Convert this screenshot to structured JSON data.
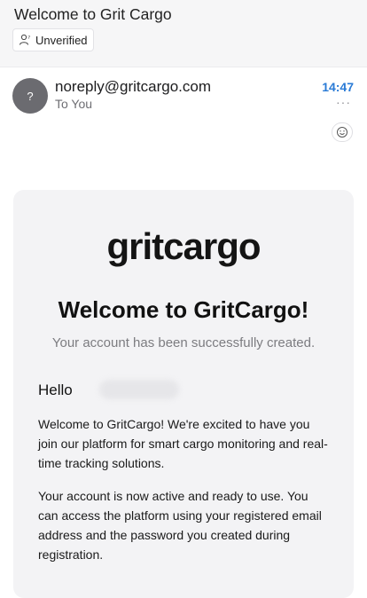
{
  "email": {
    "subject": "Welcome to Grit Cargo",
    "verification_badge": "Unverified",
    "sender_initial": "?",
    "sender": "noreply@gritcargo.com",
    "recipient": "To You",
    "time": "14:47",
    "more_label": "···"
  },
  "body": {
    "logo": "gritcargo",
    "title": "Welcome to GritCargo!",
    "subtitle": "Your account has been successfully created.",
    "greeting": "Hello",
    "paragraph1": "Welcome to GritCargo! We're excited to have you join our platform for smart cargo monitoring and real-time tracking solutions.",
    "paragraph2": "Your account is now active and ready to use. You can access the platform using your registered email address and the password you created during registration."
  },
  "icons": {
    "badge": "person-question-icon",
    "reaction": "smiley-icon",
    "more": "more-icon"
  }
}
